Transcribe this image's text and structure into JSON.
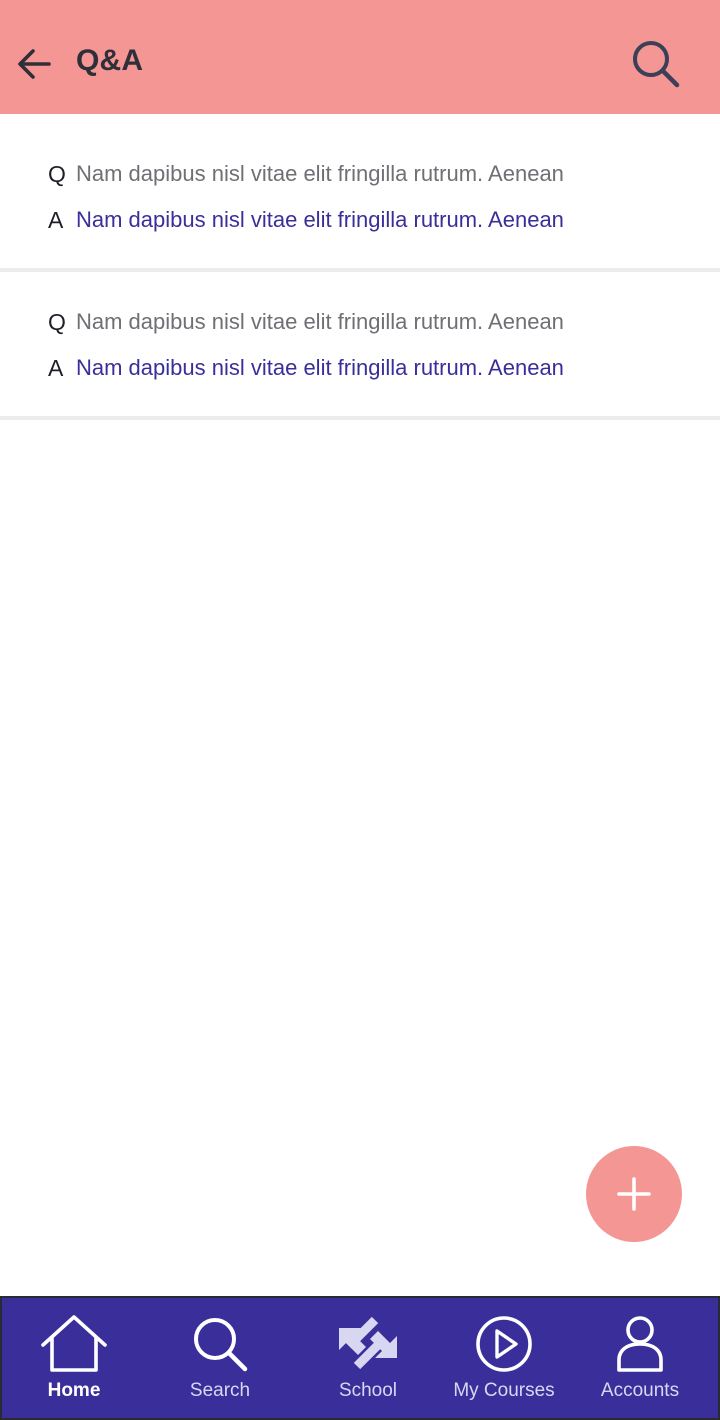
{
  "appbar": {
    "title": "Q&A",
    "back_icon": "arrow-left-icon",
    "search_icon": "search-icon",
    "background": "#f39694"
  },
  "qa": [
    {
      "q_letter": "Q",
      "question": "Nam dapibus nisl vitae elit fringilla rutrum. Aenean",
      "a_letter": "A",
      "answer": "Nam dapibus nisl vitae elit fringilla rutrum. Aenean"
    },
    {
      "q_letter": "Q",
      "question": "Nam dapibus nisl vitae elit fringilla rutrum. Aenean",
      "a_letter": "A",
      "answer": "Nam dapibus nisl vitae elit fringilla rutrum. Aenean"
    }
  ],
  "fab": {
    "icon": "plus-icon",
    "color": "#f39694"
  },
  "nav": {
    "background": "#3a2f9a",
    "items": [
      {
        "label": "Home",
        "icon": "home-icon",
        "active": true
      },
      {
        "label": "Search",
        "icon": "search-icon",
        "active": false
      },
      {
        "label": "School",
        "icon": "school-arrows-icon",
        "active": false
      },
      {
        "label": "My Courses",
        "icon": "play-circle-icon",
        "active": false
      },
      {
        "label": "Accounts",
        "icon": "user-icon",
        "active": false
      }
    ]
  }
}
